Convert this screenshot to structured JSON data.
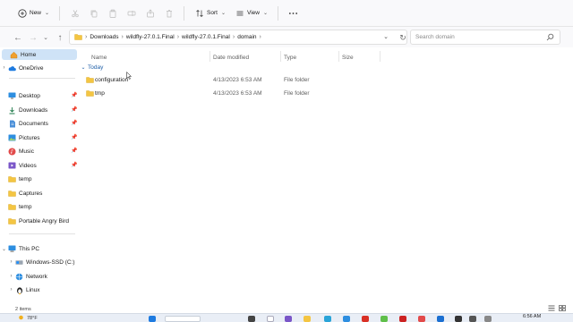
{
  "toolbar": {
    "new_label": "New",
    "sort_label": "Sort",
    "view_label": "View"
  },
  "address": {
    "crumbs": [
      "Downloads",
      "wildfly-27.0.1.Final",
      "wildfly-27.0.1.Final",
      "domain"
    ]
  },
  "search": {
    "placeholder": "Search domain"
  },
  "sidebar": {
    "home": "Home",
    "onedrive": "OneDrive",
    "quick_access": [
      {
        "label": "Desktop",
        "icon": "desktop-icon"
      },
      {
        "label": "Downloads",
        "icon": "downloads-icon"
      },
      {
        "label": "Documents",
        "icon": "documents-icon"
      },
      {
        "label": "Pictures",
        "icon": "pictures-icon"
      },
      {
        "label": "Music",
        "icon": "music-icon"
      },
      {
        "label": "Videos",
        "icon": "videos-icon"
      },
      {
        "label": "temp",
        "icon": "folder-icon"
      },
      {
        "label": "Captures",
        "icon": "folder-icon"
      },
      {
        "label": "temp",
        "icon": "folder-icon"
      },
      {
        "label": "Portable Angry Bird",
        "icon": "folder-icon"
      }
    ],
    "this_pc": "This PC",
    "drives": [
      {
        "label": "Windows-SSD (C:)",
        "icon": "drive-icon"
      },
      {
        "label": "Network",
        "icon": "network-icon"
      },
      {
        "label": "Linux",
        "icon": "linux-icon"
      }
    ]
  },
  "columns": {
    "name": "Name",
    "date": "Date modified",
    "type": "Type",
    "size": "Size"
  },
  "group": {
    "label": "Today"
  },
  "files": [
    {
      "name": "configuration",
      "date": "4/13/2023 6:53 AM",
      "type": "File folder",
      "size": ""
    },
    {
      "name": "tmp",
      "date": "4/13/2023 6:53 AM",
      "type": "File folder",
      "size": ""
    }
  ],
  "status": {
    "items": "2 items"
  },
  "taskbar": {
    "temperature": "78°F",
    "time": "6:56 AM"
  },
  "colors": {
    "accent": "#0067c0",
    "selection": "#cfe3f7",
    "folder": "#f4c542"
  }
}
